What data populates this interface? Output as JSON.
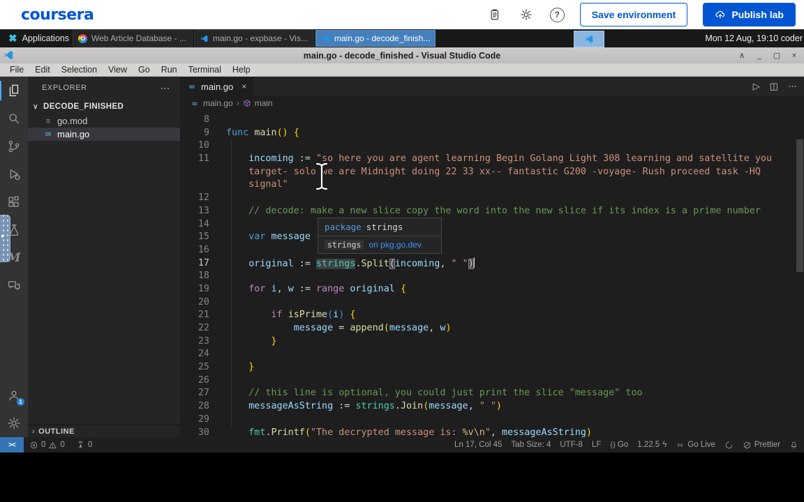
{
  "header": {
    "logo": "coursera",
    "save_label": "Save environment",
    "publish_label": "Publish lab"
  },
  "taskbar": {
    "applications_label": "Applications",
    "windows": [
      {
        "title": "Web Article Database - ...",
        "icon": "chrome",
        "active": false
      },
      {
        "title": "main.go - expbase - Vis...",
        "icon": "vscode",
        "active": false
      },
      {
        "title": "main.go - decode_finish...",
        "icon": "vscode",
        "active": true
      }
    ],
    "clock": "Mon 12 Aug, 19:10 coder"
  },
  "vscode": {
    "window_title": "main.go - decode_finished - Visual Studio Code",
    "menus": [
      "File",
      "Edit",
      "Selection",
      "View",
      "Go",
      "Run",
      "Terminal",
      "Help"
    ],
    "activity_badge": "1",
    "explorer": {
      "header": "EXPLORER",
      "project": "DECODE_FINISHED",
      "files": [
        {
          "name": "go.mod",
          "icon": "gomod",
          "selected": false
        },
        {
          "name": "main.go",
          "icon": "go",
          "selected": true
        }
      ],
      "outline_label": "OUTLINE"
    },
    "tab_label": "main.go",
    "breadcrumbs": {
      "file": "main.go",
      "symbol": "main"
    },
    "tooltip": {
      "keyword": "package",
      "package": "strings",
      "chip": "strings",
      "link": "on pkg.go.dev"
    },
    "editor": {
      "rows": [
        {
          "n": "8",
          "seg": []
        },
        {
          "n": "9",
          "seg": [
            [
              "k",
              "func "
            ],
            [
              "f",
              "main"
            ],
            [
              "b",
              "()"
            ],
            [
              "p",
              " "
            ],
            [
              "b",
              "{"
            ]
          ]
        },
        {
          "n": "10",
          "seg": []
        },
        {
          "n": "11",
          "seg": [
            [
              "p",
              "    "
            ],
            [
              "v",
              "incoming"
            ],
            [
              "p",
              " := "
            ],
            [
              "s",
              "\"so here you are agent learning Begin Golang Light 308 learning and satellite you"
            ]
          ]
        },
        {
          "n": "",
          "seg": [
            [
              "p",
              "    "
            ],
            [
              "s",
              "target- solo we are Midnight doing 22 33 xx-- fantastic G200 -voyage- Rush proceed task -HQ"
            ]
          ]
        },
        {
          "n": "",
          "seg": [
            [
              "p",
              "    "
            ],
            [
              "s",
              "signal\""
            ]
          ]
        },
        {
          "n": "12",
          "seg": []
        },
        {
          "n": "13",
          "seg": [
            [
              "p",
              "    "
            ],
            [
              "m",
              "// decode: make a new slice copy the word into the new slice if its index is a prime number"
            ]
          ]
        },
        {
          "n": "14",
          "seg": []
        },
        {
          "n": "15",
          "seg": [
            [
              "p",
              "    "
            ],
            [
              "k",
              "var "
            ],
            [
              "v",
              "message"
            ]
          ]
        },
        {
          "n": "16",
          "seg": []
        },
        {
          "n": "17",
          "active": true,
          "seg": [
            [
              "p",
              "    "
            ],
            [
              "v",
              "original"
            ],
            [
              "p",
              " := "
            ],
            [
              "hl",
              "strings"
            ],
            [
              "p",
              "."
            ],
            [
              "f",
              "Split"
            ],
            [
              "bm",
              "("
            ],
            [
              "v",
              "incoming"
            ],
            [
              "p",
              ", "
            ],
            [
              "s",
              "\" \""
            ],
            [
              "bm",
              ")"
            ],
            [
              "caret",
              ""
            ]
          ]
        },
        {
          "n": "18",
          "seg": []
        },
        {
          "n": "19",
          "seg": [
            [
              "p",
              "    "
            ],
            [
              "c",
              "for "
            ],
            [
              "v",
              "i"
            ],
            [
              "p",
              ", "
            ],
            [
              "v",
              "w"
            ],
            [
              "p",
              " := "
            ],
            [
              "c",
              "range "
            ],
            [
              "v",
              "original"
            ],
            [
              "p",
              " "
            ],
            [
              "b",
              "{"
            ]
          ]
        },
        {
          "n": "20",
          "seg": []
        },
        {
          "n": "21",
          "seg": [
            [
              "p",
              "        "
            ],
            [
              "c",
              "if "
            ],
            [
              "f",
              "isPrime"
            ],
            [
              "b2",
              "("
            ],
            [
              "v",
              "i"
            ],
            [
              "b2",
              ")"
            ],
            [
              "p",
              " "
            ],
            [
              "b",
              "{"
            ]
          ]
        },
        {
          "n": "22",
          "seg": [
            [
              "p",
              "            "
            ],
            [
              "v",
              "message"
            ],
            [
              "p",
              " = "
            ],
            [
              "f",
              "append"
            ],
            [
              "b",
              "("
            ],
            [
              "v",
              "message"
            ],
            [
              "p",
              ", "
            ],
            [
              "v",
              "w"
            ],
            [
              "b",
              ")"
            ]
          ]
        },
        {
          "n": "23",
          "seg": [
            [
              "p",
              "        "
            ],
            [
              "b",
              "}"
            ]
          ]
        },
        {
          "n": "24",
          "seg": []
        },
        {
          "n": "25",
          "seg": [
            [
              "p",
              "    "
            ],
            [
              "b",
              "}"
            ]
          ]
        },
        {
          "n": "26",
          "seg": []
        },
        {
          "n": "27",
          "seg": [
            [
              "p",
              "    "
            ],
            [
              "m",
              "// this line is optional, you could just print the slice \"message\" too"
            ]
          ]
        },
        {
          "n": "28",
          "seg": [
            [
              "p",
              "    "
            ],
            [
              "v",
              "messageAsString"
            ],
            [
              "p",
              " := "
            ],
            [
              "t",
              "strings"
            ],
            [
              "p",
              "."
            ],
            [
              "f",
              "Join"
            ],
            [
              "b",
              "("
            ],
            [
              "v",
              "message"
            ],
            [
              "p",
              ", "
            ],
            [
              "s",
              "\" \""
            ],
            [
              "b",
              ")"
            ]
          ]
        },
        {
          "n": "29",
          "seg": []
        },
        {
          "n": "30",
          "seg": [
            [
              "p",
              "    "
            ],
            [
              "t",
              "fmt"
            ],
            [
              "p",
              "."
            ],
            [
              "f",
              "Printf"
            ],
            [
              "b",
              "("
            ],
            [
              "s",
              "\"The decrypted message is: "
            ],
            [
              "e",
              "%v\\n"
            ],
            [
              "s",
              "\""
            ],
            [
              "p",
              ", "
            ],
            [
              "v",
              "messageAsString"
            ],
            [
              "b",
              ")"
            ]
          ]
        }
      ]
    },
    "status_bar": {
      "remote": "><",
      "problems": [
        {
          "icon": "error",
          "value": "0"
        },
        {
          "icon": "warning",
          "value": "0"
        },
        {
          "icon": "tower",
          "value": "0"
        }
      ],
      "items": [
        {
          "icon": "",
          "label": "Ln 17, Col 45"
        },
        {
          "icon": "",
          "label": "Tab Size: 4"
        },
        {
          "icon": "",
          "label": "UTF-8"
        },
        {
          "icon": "",
          "label": "LF"
        },
        {
          "icon": "braces",
          "label": "Go"
        },
        {
          "icon": "",
          "label": "1.22.5",
          "suffix": "ϟ"
        },
        {
          "icon": "broadcast",
          "label": "Go Live"
        },
        {
          "icon": "spinner",
          "label": ""
        },
        {
          "icon": "slash",
          "label": "Prettier"
        },
        {
          "icon": "bell",
          "label": ""
        }
      ]
    }
  }
}
